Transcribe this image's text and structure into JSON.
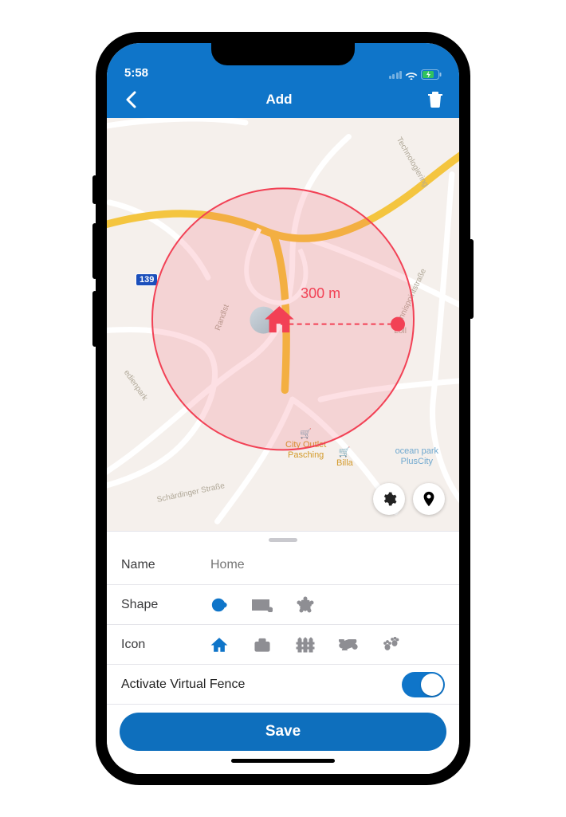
{
  "status": {
    "time": "5:58"
  },
  "nav": {
    "title": "Add",
    "back_icon": "chevron-left",
    "action_icon": "trash"
  },
  "map": {
    "highway_number": "139",
    "radius_label": "300 m",
    "poi": [
      {
        "name": "City Outlet\nPasching"
      },
      {
        "name": "Billa"
      },
      {
        "name": "ocean park\nPlusCity"
      }
    ],
    "streets": [
      "Randlst",
      "Tennispointstraße",
      "Technologiering",
      "Schärdinger Straße",
      "edienpark",
      "Loll"
    ]
  },
  "form": {
    "name_label": "Name",
    "name_placeholder": "Home",
    "shape_label": "Shape",
    "shapes": [
      "circle",
      "rectangle",
      "polygon"
    ],
    "shape_selected": "circle",
    "icon_label": "Icon",
    "icons": [
      "home",
      "briefcase",
      "fence",
      "bone",
      "paws"
    ],
    "icon_selected": "home",
    "activate_label": "Activate Virtual Fence",
    "activate_value": true,
    "save_label": "Save"
  }
}
